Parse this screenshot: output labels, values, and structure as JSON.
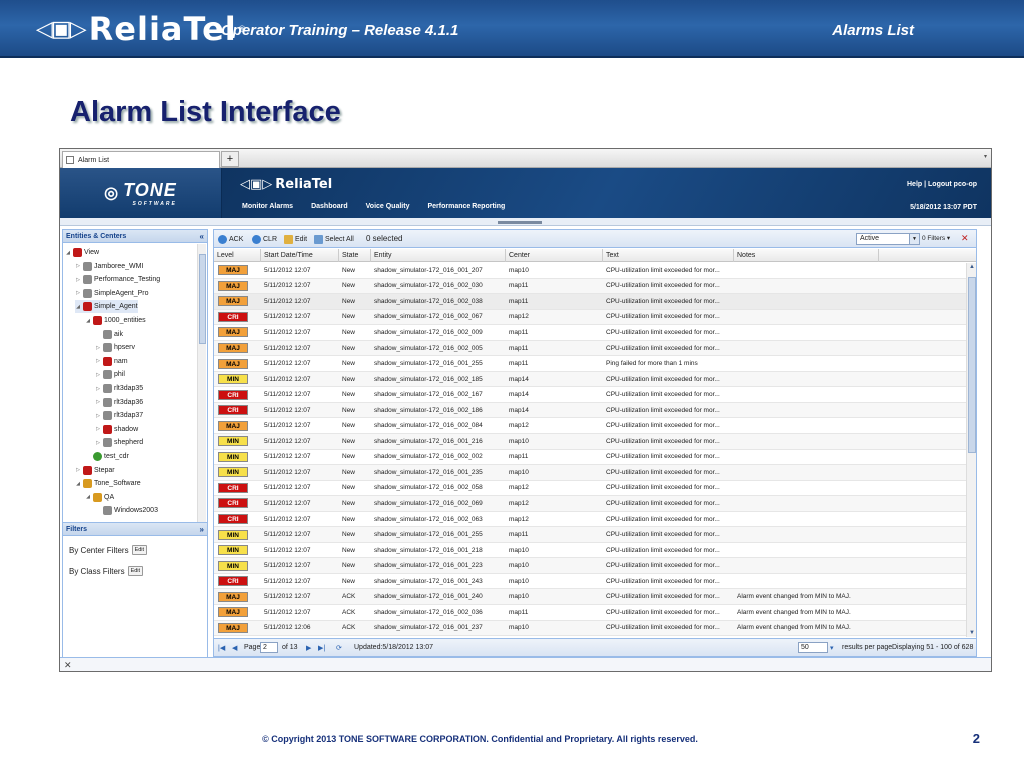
{
  "slide": {
    "course": "Operator Training – Release 4.1.1",
    "page_heading": "Alarms List",
    "title": "Alarm List Interface",
    "copyright": "© Copyright 2013 TONE SOFTWARE CORPORATION. Confidential and Proprietary. All rights reserved.",
    "number": "2",
    "brand": "ReliaTel"
  },
  "app": {
    "tab_label": "Alarm List",
    "add_tab": "+",
    "tone_logo": "TONE",
    "tone_sub": "SOFTWARE",
    "app_logo": "ReliaTel",
    "header_links": "Help | Logout pco-op",
    "header_date": "5/18/2012 13:07 PDT",
    "nav": [
      "Monitor Alarms",
      "Dashboard",
      "Voice Quality",
      "Performance Reporting"
    ]
  },
  "entities": {
    "title": "Entities & Centers",
    "tree": [
      {
        "label": "View",
        "depth": 0,
        "tw": "◢",
        "icon": "red"
      },
      {
        "label": "Jamboree_WMI",
        "depth": 1,
        "tw": "▷",
        "icon": "grey"
      },
      {
        "label": "Performance_Testing",
        "depth": 1,
        "tw": "▷",
        "icon": "grey"
      },
      {
        "label": "SimpleAgent_Pro",
        "depth": 1,
        "tw": "▷",
        "icon": "grey"
      },
      {
        "label": "Simple_Agent",
        "depth": 1,
        "tw": "◢",
        "icon": "red",
        "selected": true
      },
      {
        "label": "1000_entities",
        "depth": 2,
        "tw": "◢",
        "icon": "red"
      },
      {
        "label": "aik",
        "depth": 3,
        "tw": "",
        "icon": "grey"
      },
      {
        "label": "hpserv",
        "depth": 3,
        "tw": "▷",
        "icon": "grey"
      },
      {
        "label": "nam",
        "depth": 3,
        "tw": "▷",
        "icon": "red"
      },
      {
        "label": "phil",
        "depth": 3,
        "tw": "▷",
        "icon": "grey"
      },
      {
        "label": "rlt3dap35",
        "depth": 3,
        "tw": "▷",
        "icon": "grey"
      },
      {
        "label": "rlt3dap36",
        "depth": 3,
        "tw": "▷",
        "icon": "grey"
      },
      {
        "label": "rlt3dap37",
        "depth": 3,
        "tw": "▷",
        "icon": "grey"
      },
      {
        "label": "shadow",
        "depth": 3,
        "tw": "▷",
        "icon": "red"
      },
      {
        "label": "shepherd",
        "depth": 3,
        "tw": "▷",
        "icon": "grey"
      },
      {
        "label": "test_cdr",
        "depth": 2,
        "tw": "",
        "icon": "green"
      },
      {
        "label": "Stepar",
        "depth": 1,
        "tw": "▷",
        "icon": "red"
      },
      {
        "label": "Tone_Software",
        "depth": 1,
        "tw": "◢",
        "icon": "amber"
      },
      {
        "label": "QA",
        "depth": 2,
        "tw": "◢",
        "icon": "amber"
      },
      {
        "label": "Windows2003",
        "depth": 3,
        "tw": "",
        "icon": "grey"
      }
    ]
  },
  "filters": {
    "title": "Filters",
    "center_label": "By Center Filters",
    "class_label": "By Class Filters",
    "edit": "Edit"
  },
  "toolbar": {
    "ack": "ACK",
    "clr": "CLR",
    "edit": "Edit",
    "select_all": "Select All",
    "selected": "0 selected",
    "state": "Active",
    "filters": "0 Filters ▾"
  },
  "columns": [
    "Level",
    "Start Date/Time",
    "State",
    "Entity",
    "Center",
    "Text",
    "Notes"
  ],
  "alarms": [
    {
      "level": "MAJ",
      "time": "5/11/2012 12:07",
      "state": "New",
      "entity": "shadow_simulator-172_016_001_207",
      "center": "map10",
      "text": "CPU-utilization limit exceeded for mor...",
      "notes": ""
    },
    {
      "level": "MAJ",
      "time": "5/11/2012 12:07",
      "state": "New",
      "entity": "shadow_simulator-172_016_002_030",
      "center": "map11",
      "text": "CPU-utilization limit exceeded for mor...",
      "notes": ""
    },
    {
      "level": "MAJ",
      "time": "5/11/2012 12:07",
      "state": "New",
      "entity": "shadow_simulator-172_016_002_038",
      "center": "map11",
      "text": "CPU-utilization limit exceeded for mor...",
      "notes": ""
    },
    {
      "level": "CRI",
      "time": "5/11/2012 12:07",
      "state": "New",
      "entity": "shadow_simulator-172_016_002_067",
      "center": "map12",
      "text": "CPU-utilization limit exceeded for mor...",
      "notes": ""
    },
    {
      "level": "MAJ",
      "time": "5/11/2012 12:07",
      "state": "New",
      "entity": "shadow_simulator-172_016_002_009",
      "center": "map11",
      "text": "CPU-utilization limit exceeded for mor...",
      "notes": ""
    },
    {
      "level": "MAJ",
      "time": "5/11/2012 12:07",
      "state": "New",
      "entity": "shadow_simulator-172_016_002_005",
      "center": "map11",
      "text": "CPU-utilization limit exceeded for mor...",
      "notes": ""
    },
    {
      "level": "MAJ",
      "time": "5/11/2012 12:07",
      "state": "New",
      "entity": "shadow_simulator-172_016_001_255",
      "center": "map11",
      "text": "Ping failed for more than 1 mins",
      "notes": ""
    },
    {
      "level": "MIN",
      "time": "5/11/2012 12:07",
      "state": "New",
      "entity": "shadow_simulator-172_016_002_185",
      "center": "map14",
      "text": "CPU-utilization limit exceeded for mor...",
      "notes": ""
    },
    {
      "level": "CRI",
      "time": "5/11/2012 12:07",
      "state": "New",
      "entity": "shadow_simulator-172_016_002_167",
      "center": "map14",
      "text": "CPU-utilization limit exceeded for mor...",
      "notes": ""
    },
    {
      "level": "CRI",
      "time": "5/11/2012 12:07",
      "state": "New",
      "entity": "shadow_simulator-172_016_002_186",
      "center": "map14",
      "text": "CPU-utilization limit exceeded for mor...",
      "notes": ""
    },
    {
      "level": "MAJ",
      "time": "5/11/2012 12:07",
      "state": "New",
      "entity": "shadow_simulator-172_016_002_084",
      "center": "map12",
      "text": "CPU-utilization limit exceeded for mor...",
      "notes": ""
    },
    {
      "level": "MIN",
      "time": "5/11/2012 12:07",
      "state": "New",
      "entity": "shadow_simulator-172_016_001_216",
      "center": "map10",
      "text": "CPU-utilization limit exceeded for mor...",
      "notes": ""
    },
    {
      "level": "MIN",
      "time": "5/11/2012 12:07",
      "state": "New",
      "entity": "shadow_simulator-172_016_002_002",
      "center": "map11",
      "text": "CPU-utilization limit exceeded for mor...",
      "notes": ""
    },
    {
      "level": "MIN",
      "time": "5/11/2012 12:07",
      "state": "New",
      "entity": "shadow_simulator-172_016_001_235",
      "center": "map10",
      "text": "CPU-utilization limit exceeded for mor...",
      "notes": ""
    },
    {
      "level": "CRI",
      "time": "5/11/2012 12:07",
      "state": "New",
      "entity": "shadow_simulator-172_016_002_058",
      "center": "map12",
      "text": "CPU-utilization limit exceeded for mor...",
      "notes": ""
    },
    {
      "level": "CRI",
      "time": "5/11/2012 12:07",
      "state": "New",
      "entity": "shadow_simulator-172_016_002_069",
      "center": "map12",
      "text": "CPU-utilization limit exceeded for mor...",
      "notes": ""
    },
    {
      "level": "CRI",
      "time": "5/11/2012 12:07",
      "state": "New",
      "entity": "shadow_simulator-172_016_002_063",
      "center": "map12",
      "text": "CPU-utilization limit exceeded for mor...",
      "notes": ""
    },
    {
      "level": "MIN",
      "time": "5/11/2012 12:07",
      "state": "New",
      "entity": "shadow_simulator-172_016_001_255",
      "center": "map11",
      "text": "CPU-utilization limit exceeded for mor...",
      "notes": ""
    },
    {
      "level": "MIN",
      "time": "5/11/2012 12:07",
      "state": "New",
      "entity": "shadow_simulator-172_016_001_218",
      "center": "map10",
      "text": "CPU-utilization limit exceeded for mor...",
      "notes": ""
    },
    {
      "level": "MIN",
      "time": "5/11/2012 12:07",
      "state": "New",
      "entity": "shadow_simulator-172_016_001_223",
      "center": "map10",
      "text": "CPU-utilization limit exceeded for mor...",
      "notes": ""
    },
    {
      "level": "CRI",
      "time": "5/11/2012 12:07",
      "state": "New",
      "entity": "shadow_simulator-172_016_001_243",
      "center": "map10",
      "text": "CPU-utilization limit exceeded for mor...",
      "notes": ""
    },
    {
      "level": "MAJ",
      "time": "5/11/2012 12:07",
      "state": "ACK",
      "entity": "shadow_simulator-172_016_001_240",
      "center": "map10",
      "text": "CPU-utilization limit exceeded for mor...",
      "notes": "Alarm event changed from MIN to MAJ."
    },
    {
      "level": "MAJ",
      "time": "5/11/2012 12:07",
      "state": "ACK",
      "entity": "shadow_simulator-172_016_002_036",
      "center": "map11",
      "text": "CPU-utilization limit exceeded for mor...",
      "notes": "Alarm event changed from MIN to MAJ."
    },
    {
      "level": "MAJ",
      "time": "5/11/2012 12:06",
      "state": "ACK",
      "entity": "shadow_simulator-172_016_001_237",
      "center": "map10",
      "text": "CPU-utilization limit exceeded for mor...",
      "notes": "Alarm event changed from MIN to MAJ."
    }
  ],
  "pager": {
    "page_label": "Page",
    "page": "2",
    "of": "of 13",
    "updated": "Updated:5/18/2012 13:07",
    "per_page": "50",
    "per_page_label": "results per page",
    "displaying": "Displaying 51 - 100 of 628"
  },
  "colors": {
    "maj": "#f2a03a",
    "cri": "#cc1010",
    "min": "#f7e04a",
    "banner": "#2d66aa"
  }
}
